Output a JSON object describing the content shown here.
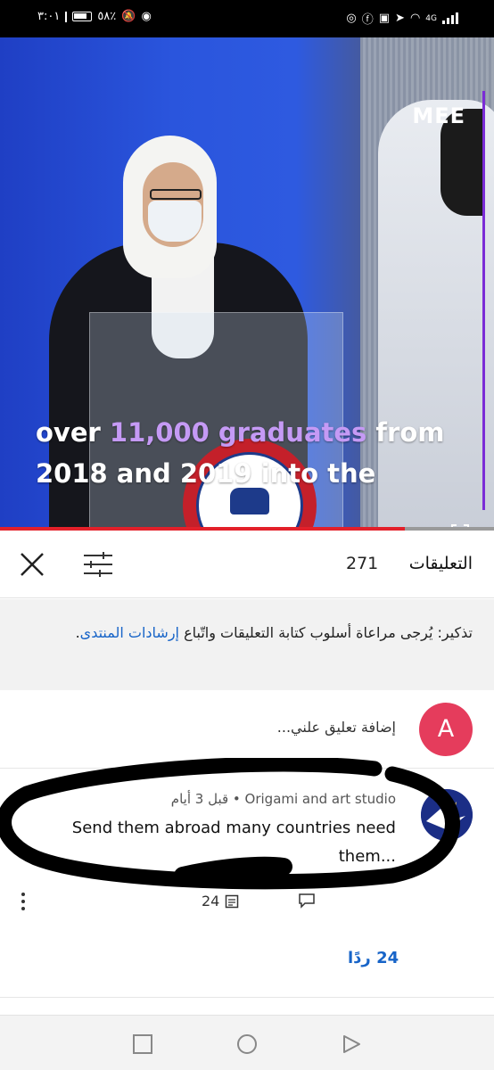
{
  "status_bar": {
    "time": "٣:٠١",
    "battery": "٥٨٪",
    "network": "4G"
  },
  "video": {
    "brand": "MEE",
    "caption_part1": "over ",
    "caption_highlight": "11,000 graduates",
    "caption_part2": " from",
    "caption_line2": "2018 and 2019 into the",
    "progress": 0.82
  },
  "comments_header": {
    "title": "التعليقات",
    "count": "271"
  },
  "reminder": {
    "text": "تذكير: يُرجى مراعاة أسلوب كتابة التعليقات واتّباع ",
    "link": "إرشادات المنتدى",
    "tail": "."
  },
  "add_comment": {
    "avatar_letter": "A",
    "placeholder": "إضافة تعليق علني..."
  },
  "comment": {
    "author": "Origami and art studio",
    "time": "قبل 3 أيام",
    "separator": " • ",
    "text": "Send them abroad  many countries need them...",
    "likes": "24",
    "replies_count": "24",
    "replies_label": "ردًا"
  },
  "colors": {
    "accent_link": "#1764c8",
    "avatar_a": "#e53c5c",
    "progress_red": "#e3202a",
    "caption_highlight": "#c59af5"
  }
}
